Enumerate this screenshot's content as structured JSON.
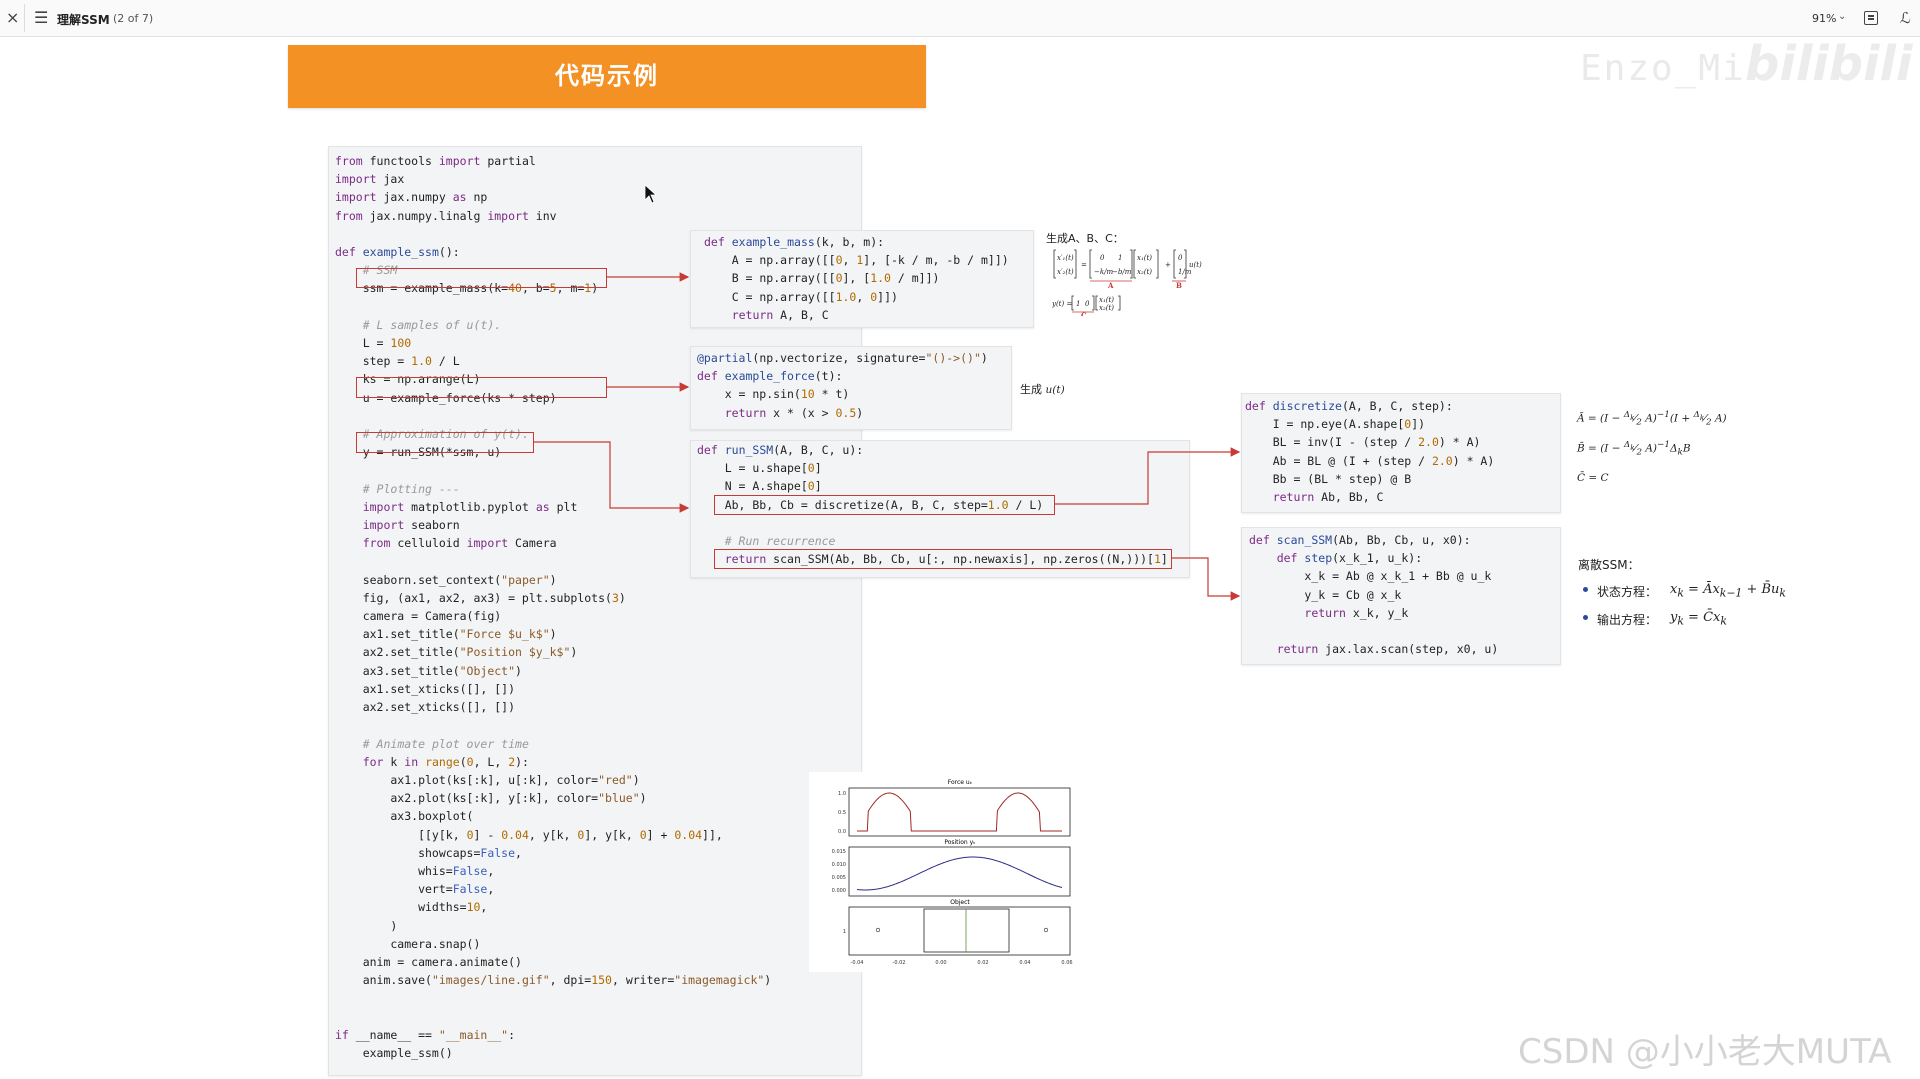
{
  "viewer": {
    "close_glyph": "×",
    "menu_glyph": "☰",
    "doc_title": "理解SSM",
    "page_indicator": "(2 of 7)",
    "zoom": "91%",
    "zoom_arrow": "⌄",
    "ext_glyph": "ℒ"
  },
  "banner": {
    "title": "代码示例"
  },
  "watermarks": {
    "top": "Enzo_Mi",
    "brand": "bilibili",
    "bottom": "CSDN @小小老大MUTA"
  },
  "main_code": [
    "from functools import partial",
    "import jax",
    "import jax.numpy as np",
    "from jax.numpy.linalg import inv",
    "",
    "def example_ssm():",
    "    # SSM",
    "    ssm = example_mass(k=40, b=5, m=1)",
    "",
    "    # L samples of u(t).",
    "    L = 100",
    "    step = 1.0 / L",
    "    ks = np.arange(L)",
    "    u = example_force(ks * step)",
    "",
    "    # Approximation of y(t).",
    "    y = run_SSM(*ssm, u)",
    "",
    "    # Plotting ---",
    "    import matplotlib.pyplot as plt",
    "    import seaborn",
    "    from celluloid import Camera",
    "",
    "    seaborn.set_context(\"paper\")",
    "    fig, (ax1, ax2, ax3) = plt.subplots(3)",
    "    camera = Camera(fig)",
    "    ax1.set_title(\"Force $u_k$\")",
    "    ax2.set_title(\"Position $y_k$\")",
    "    ax3.set_title(\"Object\")",
    "    ax1.set_xticks([], [])",
    "    ax2.set_xticks([], [])",
    "",
    "    # Animate plot over time",
    "    for k in range(0, L, 2):",
    "        ax1.plot(ks[:k], u[:k], color=\"red\")",
    "        ax2.plot(ks[:k], y[:k], color=\"blue\")",
    "        ax3.boxplot(",
    "            [[y[k, 0] - 0.04, y[k, 0], y[k, 0] + 0.04]],",
    "            showcaps=False,",
    "            whis=False,",
    "            vert=False,",
    "            widths=10,",
    "        )",
    "        camera.snap()",
    "    anim = camera.animate()",
    "    anim.save(\"images/line.gif\", dpi=150, writer=\"imagemagick\")",
    "",
    "",
    "if __name__ == \"__main__\":",
    "    example_ssm()"
  ],
  "mass_code": [
    "def example_mass(k, b, m):",
    "    A = np.array([[0, 1], [-k / m, -b / m]])",
    "    B = np.array([[0], [1.0 / m]])",
    "    C = np.array([[1.0, 0]])",
    "    return A, B, C"
  ],
  "force_code": [
    "@partial(np.vectorize, signature=\"()->()\")",
    "def example_force(t):",
    "    x = np.sin(10 * t)",
    "    return x * (x > 0.5)"
  ],
  "run_code": [
    "def run_SSM(A, B, C, u):",
    "    L = u.shape[0]",
    "    N = A.shape[0]",
    "    Ab, Bb, Cb = discretize(A, B, C, step=1.0 / L)",
    "",
    "    # Run recurrence",
    "    return scan_SSM(Ab, Bb, Cb, u[:, np.newaxis], np.zeros((N,)))[1]"
  ],
  "disc_code": [
    "def discretize(A, B, C, step):",
    "    I = np.eye(A.shape[0])",
    "    BL = inv(I - (step / 2.0) * A)",
    "    Ab = BL @ (I + (step / 2.0) * A)",
    "    Bb = (BL * step) @ B",
    "    return Ab, Bb, C"
  ],
  "scan_code": [
    "def scan_SSM(Ab, Bb, Cb, u, x0):",
    "    def step(x_k_1, u_k):",
    "        x_k = Ab @ x_k_1 + Bb @ u_k",
    "        y_k = Cb @ x_k",
    "        return x_k, y_k",
    "",
    "    return jax.lax.scan(step, x0, u)"
  ],
  "annotations": {
    "gen_abc": "生成A、B、C：",
    "gen_u": "生成",
    "gen_u_math": "u(t)",
    "discrete_ssm": "离散SSM：",
    "state_eq_label": "状态方程：",
    "output_eq_label": "输出方程：",
    "label_A": "A",
    "label_B": "B",
    "label_C": "C"
  },
  "plot": {
    "force_title": "Force uₖ",
    "position_title": "Position yₖ",
    "object_title": "Object",
    "force_yticks": [
      "1.0",
      "0.5",
      "0.0"
    ],
    "position_yticks": [
      "0.015",
      "0.010",
      "0.005",
      "0.000"
    ],
    "object_ytick": "1",
    "object_xticks": [
      "-0.04",
      "-0.02",
      "0.00",
      "0.02",
      "0.04",
      "0.06"
    ]
  },
  "colors": {
    "accent": "#f39125",
    "highlight": "#c73a35",
    "keyword": "#7b2a86",
    "force_line": "#a02828",
    "position_line": "#2b2b8a"
  }
}
